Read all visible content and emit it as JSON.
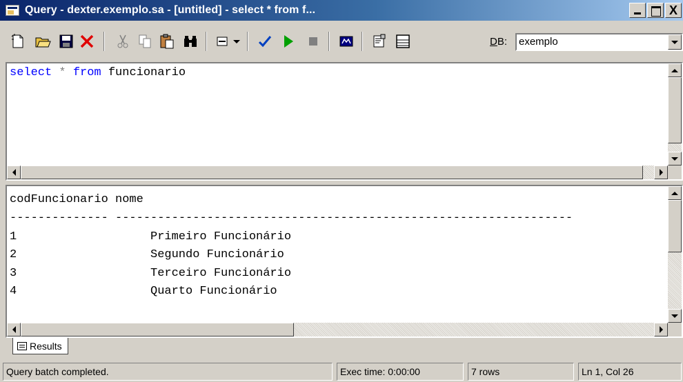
{
  "window": {
    "title": "Query - dexter.exemplo.sa - [untitled] - select * from f...",
    "close_glyph": "X"
  },
  "toolbar": {
    "buttons": [
      {
        "name": "new-query",
        "icon": "new-document-icon"
      },
      {
        "name": "open",
        "icon": "folder-open-icon"
      },
      {
        "name": "save",
        "icon": "floppy-disk-icon"
      },
      {
        "name": "delete",
        "icon": "red-x-icon"
      },
      {
        "name": "cut",
        "icon": "scissors-icon"
      },
      {
        "name": "copy",
        "icon": "copy-icon"
      },
      {
        "name": "paste",
        "icon": "clipboard-icon"
      },
      {
        "name": "find",
        "icon": "binoculars-icon"
      },
      {
        "name": "query-mode",
        "icon": "grid-dropdown-icon"
      },
      {
        "name": "parse",
        "icon": "checkmark-icon"
      },
      {
        "name": "execute",
        "icon": "play-icon"
      },
      {
        "name": "cancel",
        "icon": "stop-icon"
      },
      {
        "name": "show-plan",
        "icon": "plan-icon"
      },
      {
        "name": "options",
        "icon": "properties-icon"
      },
      {
        "name": "results-pane",
        "icon": "results-pane-icon"
      }
    ],
    "db_label_prefix": "D",
    "db_label_rest": "B:",
    "db_value": "exemplo"
  },
  "editor": {
    "kw_select": "select",
    "star": "*",
    "kw_from": "from",
    "table": "funcionario"
  },
  "results": {
    "header": "codFuncionario nome",
    "separator": "-------------- -----------------------------------------------------------------",
    "rows": [
      {
        "cod": "1",
        "nome": "Primeiro Funcionário"
      },
      {
        "cod": "2",
        "nome": "Segundo Funcionário"
      },
      {
        "cod": "3",
        "nome": "Terceiro Funcionário"
      },
      {
        "cod": "4",
        "nome": "Quarto Funcionário"
      }
    ]
  },
  "tabs": {
    "results_label": "Results"
  },
  "status": {
    "message": "Query batch completed.",
    "exec_time": "Exec time: 0:00:00",
    "rows": "7 rows",
    "position": "Ln 1, Col 26"
  },
  "colors": {
    "keyword": "#0000ff",
    "title_bar": "#0a246a",
    "chrome": "#d4d0c8"
  }
}
